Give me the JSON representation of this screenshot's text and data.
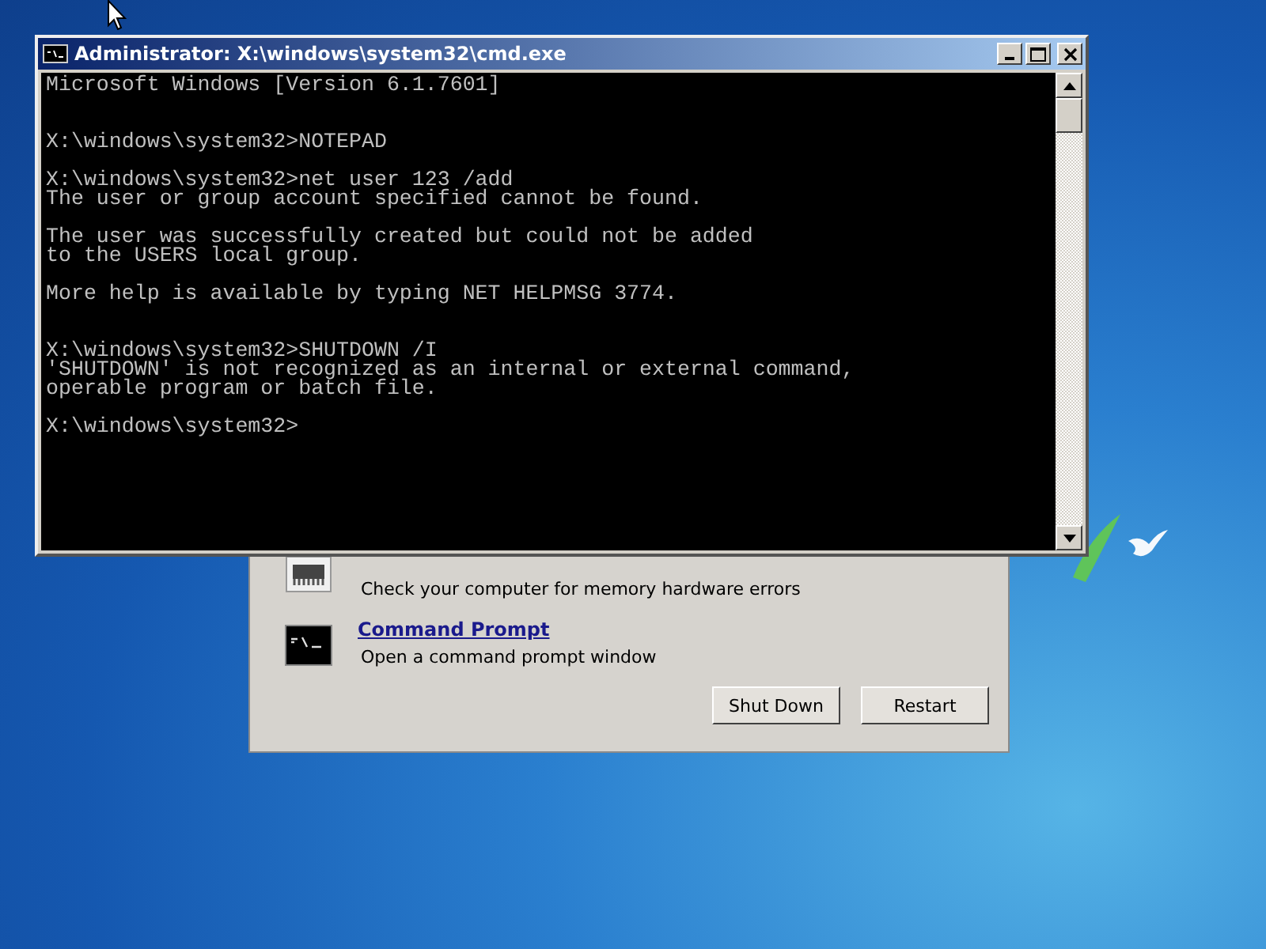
{
  "cmd_window": {
    "title": "Administrator: X:\\windows\\system32\\cmd.exe",
    "console_text": "Microsoft Windows [Version 6.1.7601]\n\n\nX:\\windows\\system32>NOTEPAD\n\nX:\\windows\\system32>net user 123 /add\nThe user or group account specified cannot be found.\n\nThe user was successfully created but could not be added\nto the USERS local group.\n\nMore help is available by typing NET HELPMSG 3774.\n\n\nX:\\windows\\system32>SHUTDOWN /I\n'SHUTDOWN' is not recognized as an internal or external command,\noperable program or batch file.\n\nX:\\windows\\system32>"
  },
  "recovery_dialog": {
    "tools": [
      {
        "kind": "memory",
        "description": "Check your computer for memory hardware errors"
      },
      {
        "kind": "console",
        "name": "Command Prompt",
        "description": "Open a command prompt window"
      }
    ],
    "buttons": [
      "Shut Down",
      "Restart"
    ]
  }
}
